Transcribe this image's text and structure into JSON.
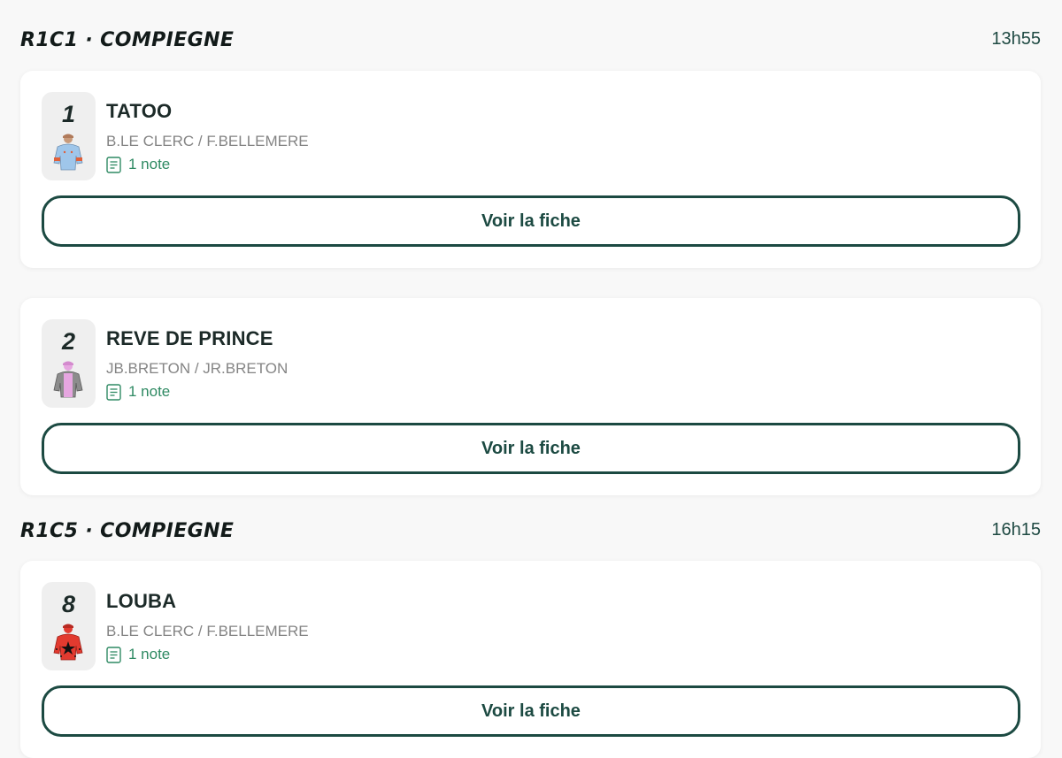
{
  "races": [
    {
      "title": "R1C1 · COMPIEGNE",
      "time": "13h55",
      "runners": [
        {
          "number": "1",
          "name": "TATOO",
          "people": "B.LE CLERC / F.BELLEMERE",
          "notes": "1 note",
          "button": "Voir la fiche",
          "silk_colors": {
            "body": "#9fc6ea",
            "sleeves": "#9fc6ea",
            "accent": "#e0603a",
            "cap": "#c89a7a"
          }
        },
        {
          "number": "2",
          "name": "REVE DE PRINCE",
          "people": "JB.BRETON / JR.BRETON",
          "notes": "1 note",
          "button": "Voir la fiche",
          "silk_colors": {
            "body": "#e6a6e0",
            "sleeves": "#8c8c8c",
            "accent": "#e6a6e0",
            "cap": "#e6a6e0"
          }
        }
      ]
    },
    {
      "title": "R1C5 · COMPIEGNE",
      "time": "16h15",
      "runners": [
        {
          "number": "8",
          "name": "LOUBA",
          "people": "B.LE CLERC / F.BELLEMERE",
          "notes": "1 note",
          "button": "Voir la fiche",
          "silk_colors": {
            "body": "#e23a2f",
            "sleeves": "#e23a2f",
            "accent": "#111111",
            "cap": "#e23a2f"
          }
        }
      ]
    }
  ]
}
